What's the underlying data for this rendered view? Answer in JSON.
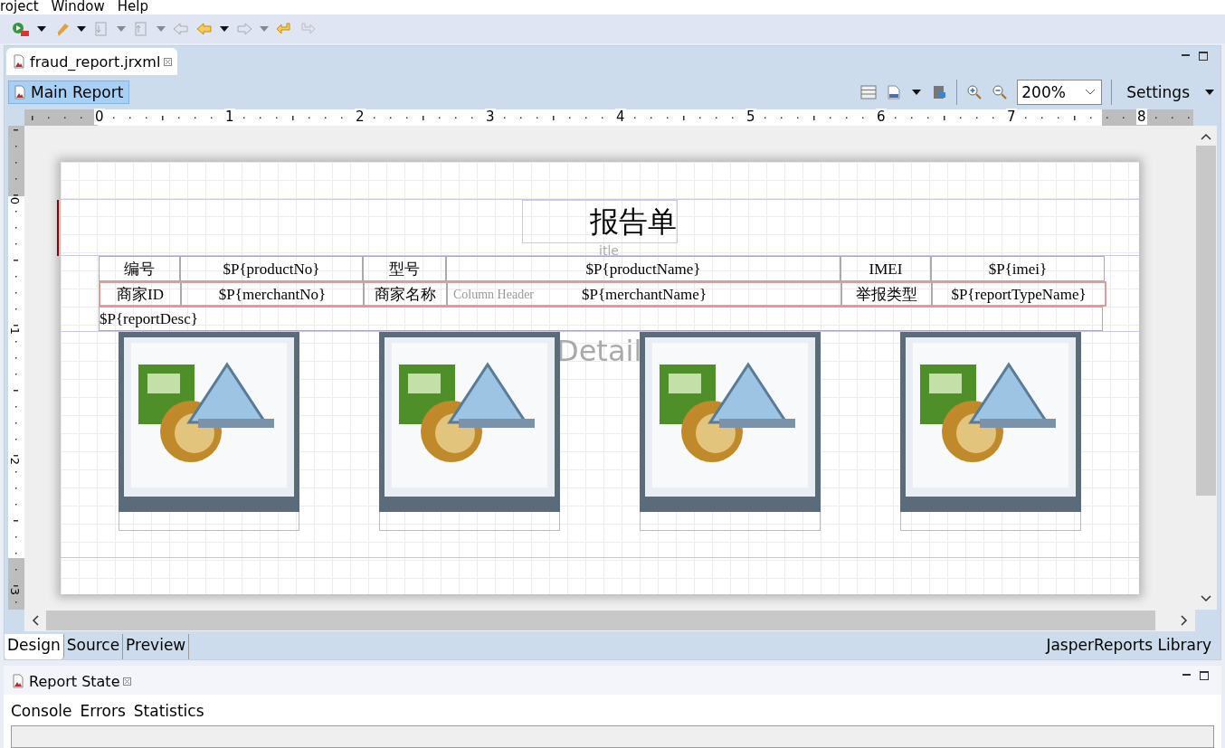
{
  "menu": [
    "roject",
    "Window",
    "Help"
  ],
  "editor_tab": {
    "label": "fraud_report.jrxml"
  },
  "report_toolbar": {
    "main_report": {
      "label": "Main Report",
      "selected": true
    },
    "zoom": "200%",
    "settings": "Settings"
  },
  "ruler": {
    "horizontal": [
      "0",
      "1",
      "2",
      "3",
      "4",
      "5",
      "6",
      "7",
      "8"
    ],
    "vertical": [
      "0",
      "1",
      "2",
      "3"
    ]
  },
  "report": {
    "bands": [
      {
        "label": "itle"
      },
      {
        "label": "Column Header"
      },
      {
        "label": "Detail"
      }
    ],
    "title": "报告单",
    "rows": [
      {
        "highlighted": false,
        "cells": [
          "编号",
          "$P{productNo}",
          "型号",
          "$P{productName}",
          "IMEI",
          "$P{imei}"
        ]
      },
      {
        "highlighted": true,
        "cells": [
          "商家ID",
          "$P{merchantNo}",
          "商家名称",
          "$P{merchantName}",
          "举报类型",
          "$P{reportTypeName}"
        ]
      }
    ],
    "description": "$P{reportDesc}",
    "images": [
      {
        "kind": "image"
      },
      {
        "kind": "image"
      },
      {
        "kind": "image"
      },
      {
        "kind": "image"
      }
    ]
  },
  "editor_tabs": [
    {
      "label": "Design",
      "selected": true
    },
    {
      "label": "Source",
      "selected": false
    },
    {
      "label": "Preview",
      "selected": false
    }
  ],
  "library": "JasperReports Library",
  "panel": {
    "title": "Report State",
    "tabs": [
      "Console",
      "Errors",
      "Statistics"
    ]
  }
}
